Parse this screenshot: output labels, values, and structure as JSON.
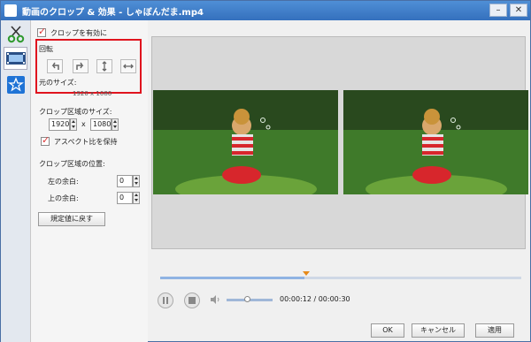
{
  "window": {
    "title": "動画のクロップ & 効果 - しゃぼんだま.mp4",
    "minimize_glyph": "–",
    "close_glyph": "✕"
  },
  "sidebar": {
    "tabs": [
      {
        "name": "crop",
        "icon": "scissors-icon"
      },
      {
        "name": "effects",
        "icon": "film-effect-icon"
      },
      {
        "name": "watermark",
        "icon": "star-icon"
      }
    ]
  },
  "crop_panel": {
    "enable_crop_label": "クロップを有効に",
    "enable_crop_checked": true,
    "rotate_label": "回転",
    "rotate_buttons": [
      {
        "name": "rotate-left",
        "icon": "rotate-left-icon"
      },
      {
        "name": "rotate-right",
        "icon": "rotate-right-icon"
      },
      {
        "name": "flip-vertical",
        "icon": "flip-vertical-icon"
      },
      {
        "name": "flip-horizontal",
        "icon": "flip-horizontal-icon"
      }
    ],
    "original_size_label": "元のサイズ:",
    "original_size_value": "1920 x 1080",
    "crop_size_label": "クロップ区域のサイズ:",
    "width_value": "1920",
    "x_separator": "x",
    "height_value": "1080",
    "keep_aspect_label": "アスペクト比を保持",
    "keep_aspect_checked": true,
    "crop_position_label": "クロップ区域の位置:",
    "left_margin_label": "左の余白:",
    "left_margin_value": "0",
    "top_margin_label": "上の余白:",
    "top_margin_value": "0",
    "reset_button": "規定値に戻す"
  },
  "player": {
    "time_display": "00:00:12 / 00:00:30",
    "progress_fraction": 0.4,
    "volume_fraction": 0.45
  },
  "footer": {
    "ok": "OK",
    "cancel": "キャンセル",
    "apply": "適用"
  },
  "colors": {
    "accent_red": "#e0141e",
    "titlebar": "#3b78c6",
    "marker": "#e68a1a"
  }
}
